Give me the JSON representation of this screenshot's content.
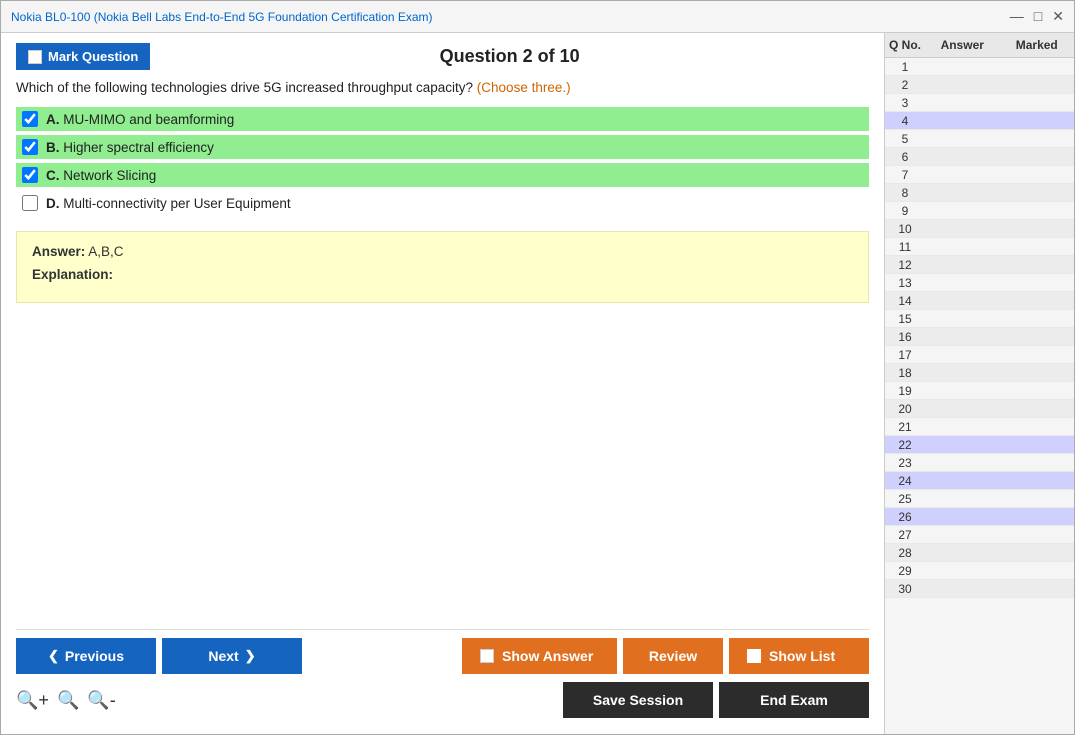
{
  "window": {
    "title": "Nokia BL0-100 (Nokia Bell Labs End-to-End 5G Foundation Certification Exam)",
    "controls": [
      "—",
      "□",
      "✕"
    ]
  },
  "toolbar": {
    "mark_question_label": "Mark Question",
    "question_title": "Question 2 of 10"
  },
  "question": {
    "text": "Which of the following technologies drive 5G increased throughput capacity?",
    "choose_hint": "(Choose three.)",
    "answers": [
      {
        "letter": "A",
        "text": "MU-MIMO and beamforming",
        "correct": true,
        "checked": true
      },
      {
        "letter": "B",
        "text": "Higher spectral efficiency",
        "correct": true,
        "checked": true
      },
      {
        "letter": "C",
        "text": "Network Slicing",
        "correct": true,
        "checked": true
      },
      {
        "letter": "D",
        "text": "Multi-connectivity per User Equipment",
        "correct": false,
        "checked": false
      }
    ]
  },
  "answer_box": {
    "answer_label": "Answer:",
    "answer_value": "A,B,C",
    "explanation_label": "Explanation:"
  },
  "buttons": {
    "previous": "Previous",
    "next": "Next",
    "show_answer": "Show Answer",
    "review": "Review",
    "show_list": "Show List",
    "save_session": "Save Session",
    "end_exam": "End Exam"
  },
  "sidebar": {
    "headers": [
      "Q No.",
      "Answer",
      "Marked"
    ],
    "rows": [
      {
        "num": 1,
        "answer": "",
        "marked": ""
      },
      {
        "num": 2,
        "answer": "",
        "marked": ""
      },
      {
        "num": 3,
        "answer": "",
        "marked": ""
      },
      {
        "num": 4,
        "answer": "",
        "marked": "",
        "highlight": true
      },
      {
        "num": 5,
        "answer": "",
        "marked": ""
      },
      {
        "num": 6,
        "answer": "",
        "marked": ""
      },
      {
        "num": 7,
        "answer": "",
        "marked": ""
      },
      {
        "num": 8,
        "answer": "",
        "marked": ""
      },
      {
        "num": 9,
        "answer": "",
        "marked": ""
      },
      {
        "num": 10,
        "answer": "",
        "marked": ""
      },
      {
        "num": 11,
        "answer": "",
        "marked": ""
      },
      {
        "num": 12,
        "answer": "",
        "marked": ""
      },
      {
        "num": 13,
        "answer": "",
        "marked": ""
      },
      {
        "num": 14,
        "answer": "",
        "marked": ""
      },
      {
        "num": 15,
        "answer": "",
        "marked": ""
      },
      {
        "num": 16,
        "answer": "",
        "marked": ""
      },
      {
        "num": 17,
        "answer": "",
        "marked": ""
      },
      {
        "num": 18,
        "answer": "",
        "marked": ""
      },
      {
        "num": 19,
        "answer": "",
        "marked": ""
      },
      {
        "num": 20,
        "answer": "",
        "marked": ""
      },
      {
        "num": 21,
        "answer": "",
        "marked": ""
      },
      {
        "num": 22,
        "answer": "",
        "marked": "",
        "highlight": true
      },
      {
        "num": 23,
        "answer": "",
        "marked": ""
      },
      {
        "num": 24,
        "answer": "",
        "marked": "",
        "highlight": true
      },
      {
        "num": 25,
        "answer": "",
        "marked": ""
      },
      {
        "num": 26,
        "answer": "",
        "marked": "",
        "highlight": true
      },
      {
        "num": 27,
        "answer": "",
        "marked": ""
      },
      {
        "num": 28,
        "answer": "",
        "marked": ""
      },
      {
        "num": 29,
        "answer": "",
        "marked": ""
      },
      {
        "num": 30,
        "answer": "",
        "marked": ""
      }
    ]
  },
  "zoom": {
    "icons": [
      "zoom-in",
      "zoom-reset",
      "zoom-out"
    ]
  }
}
